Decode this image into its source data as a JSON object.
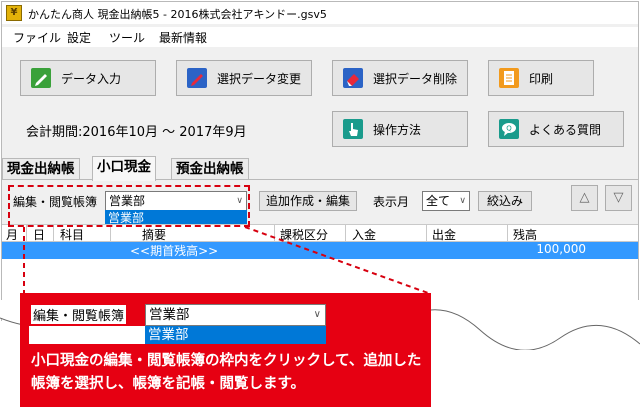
{
  "window": {
    "title": "かんたん商人 現金出納帳5 - 2016株式会社アキンドー.gsv5",
    "app_icon": "yen-app-icon"
  },
  "menu": [
    "ファイル",
    "設定",
    "ツール",
    "最新情報"
  ],
  "toolbar": {
    "data_entry": "データ入力",
    "change_selection": "選択データ変更",
    "delete_selection": "選択データ削除",
    "print": "印刷",
    "how_to": "操作方法",
    "faq": "よくある質問"
  },
  "period": "会計期間:2016年10月 ～ 2017年9月",
  "tabs": [
    "現金出納帳",
    "小口現金",
    "預金出納帳"
  ],
  "active_tab": "小口現金",
  "filter": {
    "ledger_label": "編集・閲覧帳簿",
    "ledger_value": "営業部",
    "ledger_option": "営業部",
    "add_button": "追加作成・編集",
    "month_label": "表示月",
    "month_value": "全て",
    "narrow_button": "絞込み",
    "up_arrow": "△",
    "down_arrow": "▽"
  },
  "grid": {
    "columns": [
      "月",
      "日",
      "科目",
      "摘要",
      "課税区分",
      "入金",
      "出金",
      "残高"
    ],
    "rows": [
      {
        "description": "<<期首残高>>",
        "balance": "100,000"
      }
    ]
  },
  "callout": {
    "label": "編集・閲覧帳簿",
    "value": "営業部",
    "option": "営業部",
    "text": "小口現金の編集・閲覧帳簿の枠内をクリックして、追加した帳簿を選択し、帳簿を記帳・閲覧します。"
  },
  "colors": {
    "accent_red": "#e60012",
    "selection_blue": "#0078d7",
    "row_highlight": "#3399ff"
  }
}
